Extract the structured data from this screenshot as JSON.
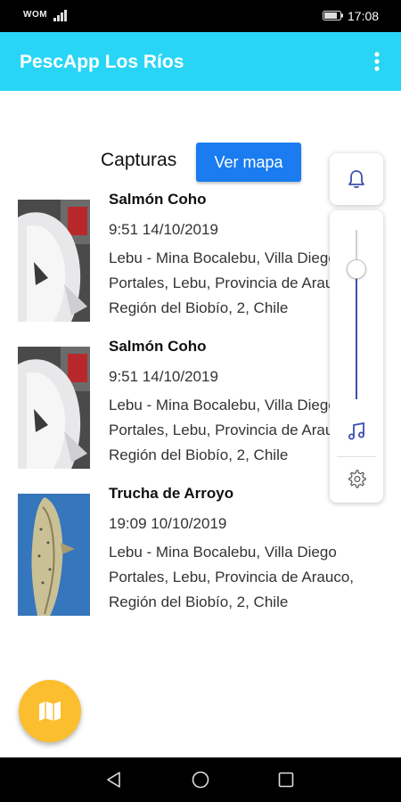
{
  "status_bar": {
    "carrier": "WOM",
    "time": "17:08"
  },
  "app_bar": {
    "title": "PescApp Los Ríos",
    "menu_icon": "overflow-menu-icon"
  },
  "header": {
    "title": "Capturas",
    "map_button_label": "Ver mapa"
  },
  "captures": [
    {
      "species": "Salmón Coho",
      "datetime": "9:51 14/10/2019",
      "location": "Lebu - Mina Bocalebu, Villa Diego Portales, Lebu, Provincia de Arauco, Región del Biobío, 2, Chile",
      "photo": "salmon-photo"
    },
    {
      "species": "Salmón Coho",
      "datetime": "9:51 14/10/2019",
      "location": "Lebu - Mina Bocalebu, Villa Diego Portales, Lebu, Provincia de Arauco, Región del Biobío, 2, Chile",
      "photo": "salmon-photo"
    },
    {
      "species": "Trucha de Arroyo",
      "datetime": "19:09 10/10/2019",
      "location": "Lebu - Mina Bocalebu, Villa Diego Portales, Lebu, Provincia de Arauco, Región del Biobío, 2, Chile",
      "photo": "trout-photo"
    }
  ],
  "volume_panel": {
    "level": 0.77,
    "icons": [
      "bell-icon",
      "music-note-icon",
      "settings-gear-icon"
    ],
    "accent": "#3b4fb0"
  },
  "fab": {
    "icon": "map-icon",
    "color": "#fbbe2e"
  },
  "colors": {
    "app_bar": "#29d5f5",
    "button": "#1a7cf0"
  },
  "nav_bar": {
    "icons": [
      "back-icon",
      "home-icon",
      "recents-icon"
    ]
  }
}
